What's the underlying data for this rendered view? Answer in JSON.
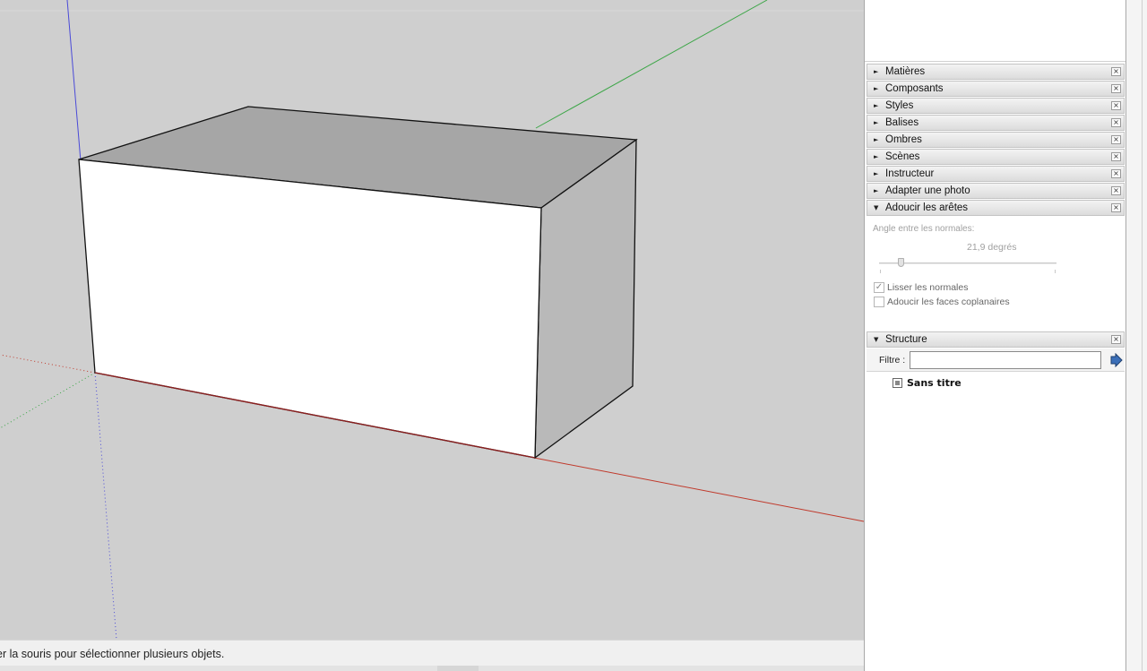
{
  "viewport": {
    "background": "#cfcfcf",
    "axis_colors": {
      "red": "#c0392b",
      "green": "#3da648",
      "blue": "#4a4ad8"
    },
    "box_faces": {
      "top": "#a6a6a6",
      "front": "#ffffff",
      "side": "#b9b9b9",
      "edge": "#111111"
    }
  },
  "statusbar": {
    "message": "er la souris pour sélectionner plusieurs objets."
  },
  "tray": {
    "panels": [
      {
        "title": "Matières",
        "expanded": false
      },
      {
        "title": "Composants",
        "expanded": false
      },
      {
        "title": "Styles",
        "expanded": false
      },
      {
        "title": "Balises",
        "expanded": false
      },
      {
        "title": "Ombres",
        "expanded": false
      },
      {
        "title": "Scènes",
        "expanded": false
      },
      {
        "title": "Instructeur",
        "expanded": false
      },
      {
        "title": "Adapter une photo",
        "expanded": false
      },
      {
        "title": "Adoucir les arêtes",
        "expanded": true
      }
    ],
    "soften": {
      "angle_label": "Angle entre les normales:",
      "angle_value": "21,9  degrés",
      "smooth_normals_label": "Lisser les normales",
      "smooth_normals_checked": true,
      "coplanar_label": "Adoucir les faces coplanaires",
      "coplanar_checked": false
    },
    "structure": {
      "title": "Structure",
      "filter_label": "Filtre :",
      "filter_value": "",
      "root_name": "Sans titre"
    },
    "close_glyph": "×",
    "collapsed_glyph": "►",
    "expanded_glyph": "▼"
  }
}
